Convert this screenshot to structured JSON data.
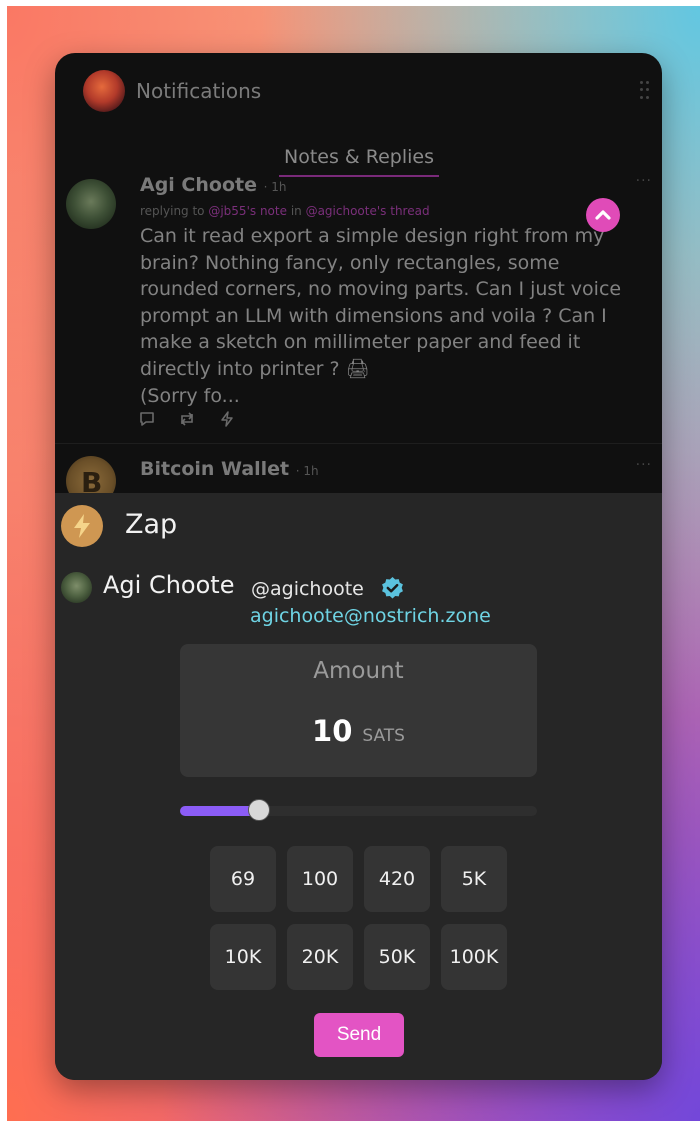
{
  "header": {
    "title": "Notifications",
    "active_tab": "Notes & Replies"
  },
  "note": {
    "author": "Agi Choote",
    "time": "· 1h",
    "reply_prefix": "replying to ",
    "reply_mention": "@jb55",
    "reply_mid1": "'s ",
    "reply_note": "note",
    "reply_mid2": " in ",
    "reply_thread_owner": "@agichoote",
    "reply_mid3": "'s ",
    "reply_thread": "thread",
    "body": "Can it read export a simple design right from my brain? Nothing fancy, only rectangles, some rounded corners, no moving parts. Can I just voice prompt an LLM with dimensions and voila ? Can I make a sketch on millimeter paper and feed it directly into printer ? 🖨\n(Sorry fo...",
    "more": "···"
  },
  "note2": {
    "author": "Bitcoin Wallet",
    "time": "· 1h",
    "avatar_glyph": "B",
    "more": "···"
  },
  "zap": {
    "title": "Zap",
    "recipient_name": "Agi Choote",
    "recipient_handle": "@agichoote",
    "recipient_nip05": "agichoote@nostrich.zone",
    "amount_label": "Amount",
    "amount_value": "10",
    "amount_unit": "SATS",
    "slider_fraction": 0.22,
    "presets": [
      "69",
      "100",
      "420",
      "5K",
      "10K",
      "20K",
      "50K",
      "100K"
    ],
    "send_label": "Send"
  },
  "colors": {
    "accent_pink": "#e354c4",
    "slider_purple": "#8b5cf6",
    "nip05_cyan": "#6fd4e4",
    "zap_orange": "#cf9752"
  }
}
